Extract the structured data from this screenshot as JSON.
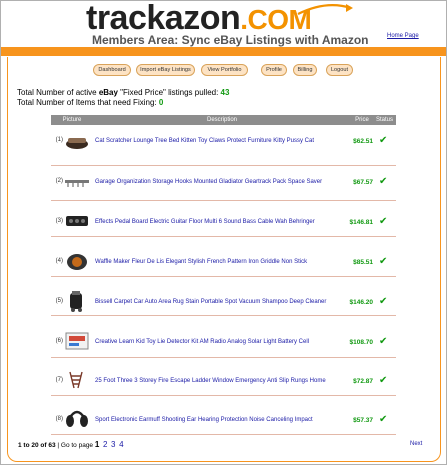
{
  "brand": {
    "name": "trackazon",
    "tld": ".COM"
  },
  "subtitle": "Members Area: Sync eBay Listings with Amazon",
  "home_link": "Home Page",
  "nav": [
    {
      "label": "Dashboard"
    },
    {
      "label": "Import eBay Listings"
    },
    {
      "label": "View Portfolio"
    },
    {
      "label": "Profile"
    },
    {
      "label": "Billing"
    },
    {
      "label": "Logout"
    }
  ],
  "stats": {
    "line1_prefix": "Total Number of active ",
    "line1_ebay": "eBay",
    "line1_mid": " \"Fixed Price\" listings pulled: ",
    "line1_value": "43",
    "line2_prefix": "Total Number of Items that need Fixing: ",
    "line2_value": "0"
  },
  "table": {
    "headers": {
      "picture": "Picture",
      "description": "Description",
      "price": "Price",
      "status": "Status"
    },
    "rows": [
      {
        "num": "(1)",
        "picture": "cat-scratcher-lounge",
        "description": "Cat Scratcher Lounge Tree Bed Kitten Toy Claws Protect Furniture Kitty Pussy Cat",
        "price": "$62.51",
        "status": "check-icon"
      },
      {
        "num": "(2)",
        "picture": "garage-hooks",
        "description": "Garage Organization Storage Hooks Mounted Gladiator Geartrack Pack Space Saver",
        "price": "$67.57",
        "status": "check-icon"
      },
      {
        "num": "(3)",
        "picture": "effects-pedal-board",
        "description": "Effects Pedal Board Electric Guitar Floor Multi 6 Sound Bass Cable Wah Behringer",
        "price": "$146.81",
        "status": "check-icon"
      },
      {
        "num": "(4)",
        "picture": "waffle-maker",
        "description": "Waffle Maker Fleur De Lis Elegant Stylish French Pattern Iron Griddle Non Stick",
        "price": "$85.51",
        "status": "check-icon"
      },
      {
        "num": "(5)",
        "picture": "carpet-cleaner",
        "description": "Bissell Carpet Car Auto Area Rug Stain Portable Spot Vacuum Shampoo Deep Cleaner",
        "price": "$146.20",
        "status": "check-icon"
      },
      {
        "num": "(6)",
        "picture": "lie-detector-kit",
        "description": "Creative Learn Kid Toy Lie Detector Kit AM Radio Analog Solar Light Battery Cell",
        "price": "$108.70",
        "status": "check-icon"
      },
      {
        "num": "(7)",
        "picture": "fire-escape-ladder",
        "description": "25 Foot Three 3 Storey Fire Escape Ladder Window Emergency Anti Slip Rungs Home",
        "price": "$72.87",
        "status": "check-icon"
      },
      {
        "num": "(8)",
        "picture": "earmuffs",
        "description": "Sport Electronic Earmuff Shooting Ear Hearing Protection Noise Canceling Impact",
        "price": "$57.37",
        "status": "check-icon"
      }
    ]
  },
  "pager": {
    "range": "1 to 20 of 63",
    "goto": "| Go to page",
    "pages": [
      "1",
      "2",
      "3",
      "4"
    ],
    "next": "Next"
  },
  "colors": {
    "accent": "#f7941d",
    "price_green": "#119911",
    "link_blue": "#1a1aa6"
  }
}
